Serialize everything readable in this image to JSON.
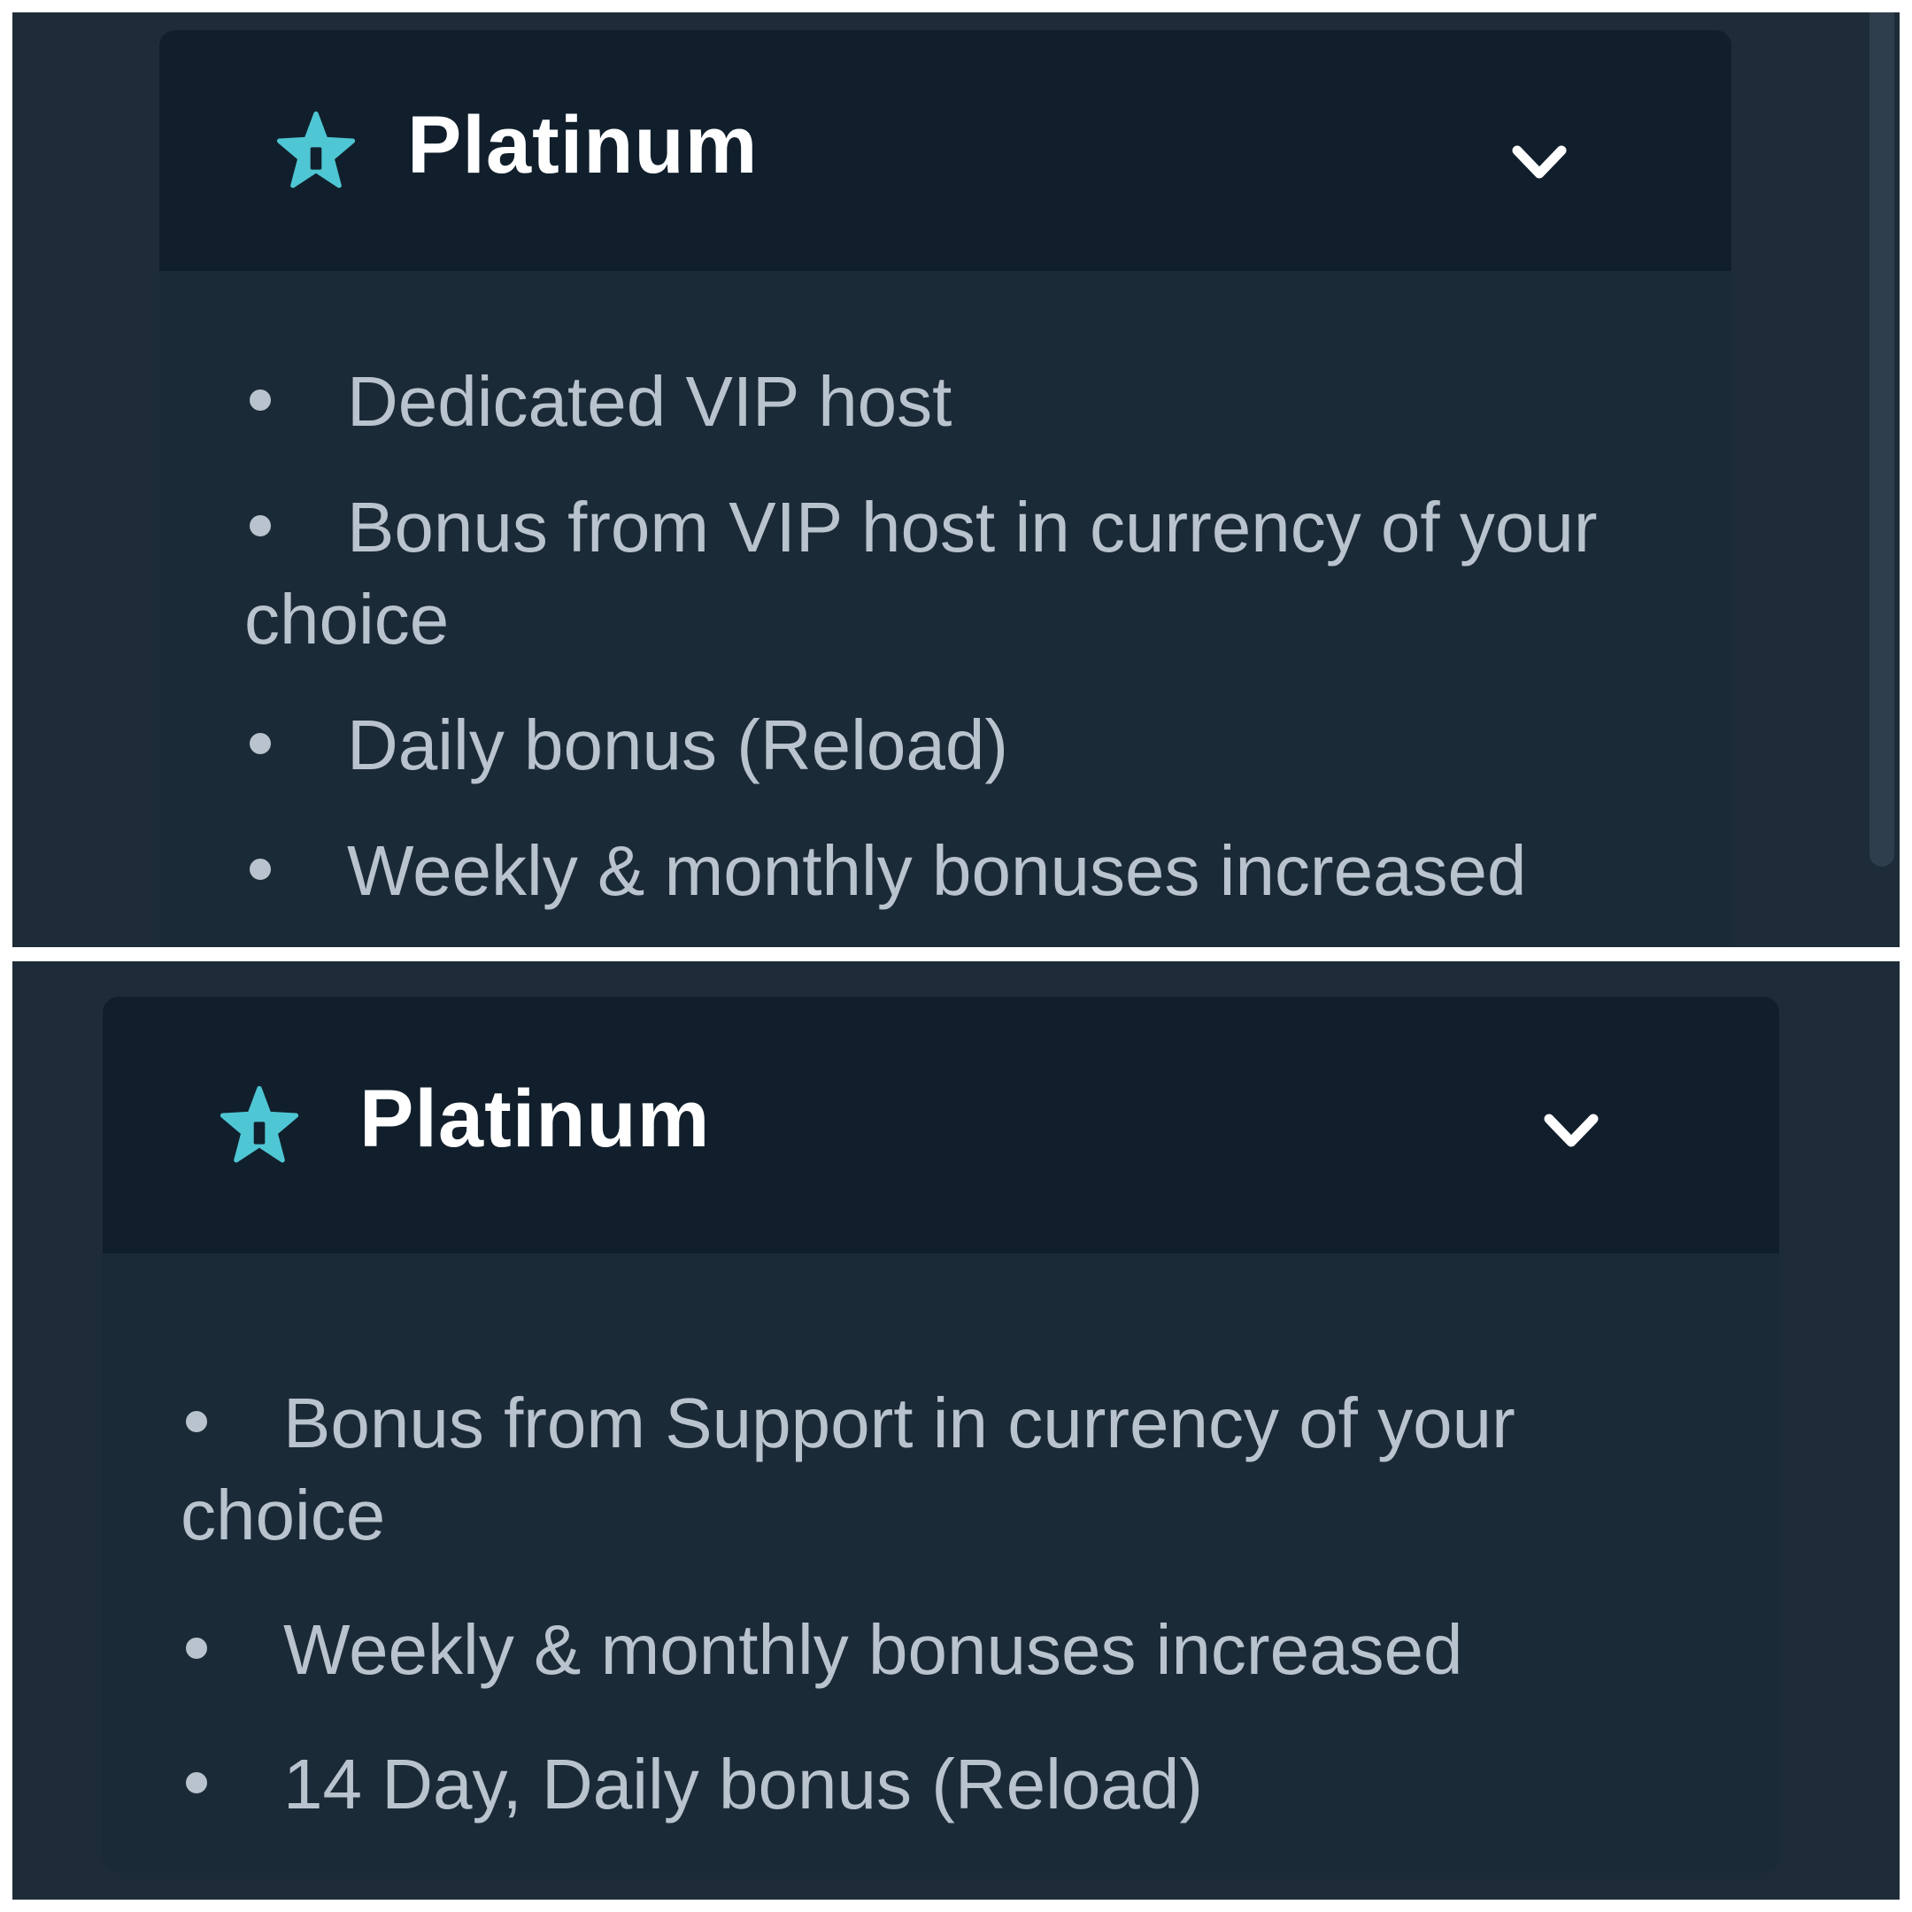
{
  "panels": [
    {
      "tier": {
        "icon": "star-icon",
        "title": "Platinum",
        "toggle_icon": "chevron-down-icon"
      },
      "benefits": [
        "Dedicated VIP host",
        "Bonus from VIP host in currency of your choice",
        "Daily bonus (Reload)",
        "Weekly & monthly bonuses increased"
      ]
    },
    {
      "tier": {
        "icon": "star-icon",
        "title": "Platinum",
        "toggle_icon": "chevron-down-icon"
      },
      "benefits": [
        "Bonus from Support in currency of your choice",
        "Weekly & monthly bonuses increased",
        "14 Day, Daily bonus (Reload)"
      ]
    }
  ],
  "colors": {
    "page_background": "#1e2c39",
    "header_background": "#111f2c",
    "accent": "#4fc6d4",
    "title_text": "#ffffff",
    "body_text": "#b9c3cd"
  }
}
